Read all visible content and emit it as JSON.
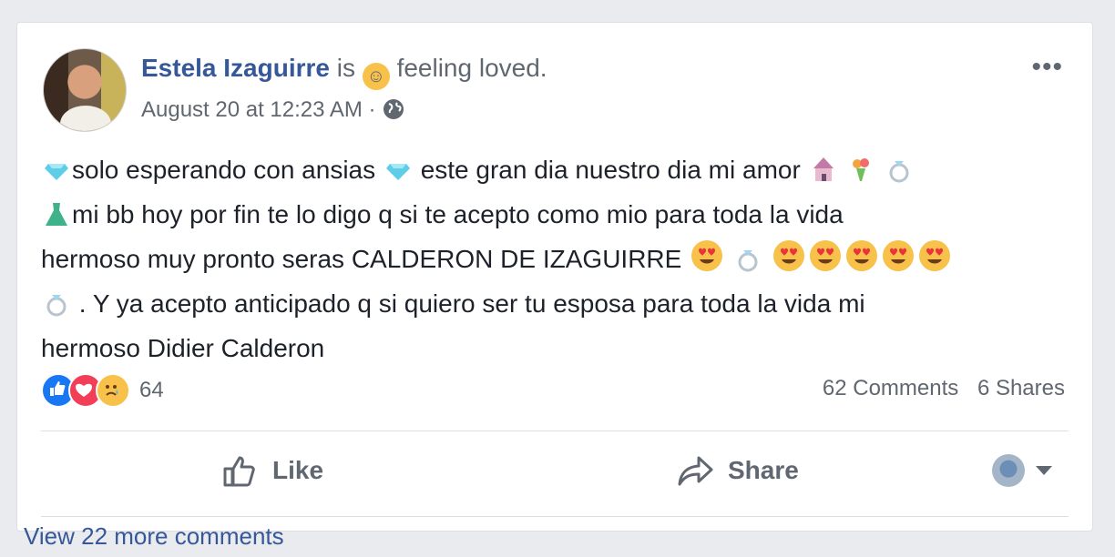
{
  "post": {
    "author": "Estela Izaguirre",
    "is_text": "is",
    "feeling_text": "feeling loved.",
    "timestamp": "August 20 at 12:23 AM",
    "timestamp_sep": "·",
    "more_label": "•••",
    "body": {
      "line1a": "solo esperando con ansias",
      "line1b": "este gran dia nuestro dia mi amor",
      "line2": "mi bb hoy por fin te lo digo q si te acepto como mio para toda la vida",
      "line3": "hermoso muy pronto seras CALDERON DE IZAGUIRRE",
      "line4": ". Y ya acepto anticipado q si quiero ser tu esposa para toda la vida mi",
      "line5": "hermoso Didier Calderon"
    }
  },
  "reactions": {
    "count": "64",
    "types": [
      "like-icon",
      "love-icon",
      "sad-icon"
    ]
  },
  "stats": {
    "comments": "62 Comments",
    "shares": "6 Shares"
  },
  "actions": {
    "like": "Like",
    "share": "Share"
  },
  "comments": {
    "view_more": "View 22 more comments"
  },
  "colors": {
    "link": "#365899",
    "secondary_text": "#606770",
    "body_text": "#1d2129",
    "like_blue": "#1877f2",
    "love_red": "#f33e58"
  }
}
